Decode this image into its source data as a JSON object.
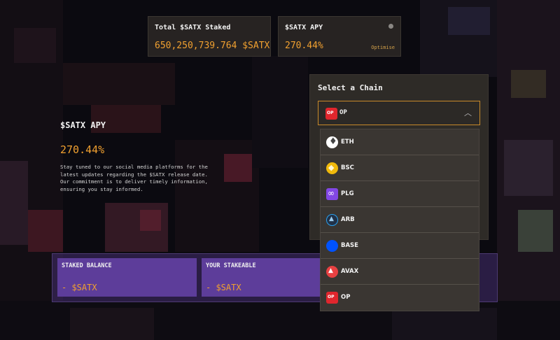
{
  "stats": {
    "total_staked_label": "Total $SATX Staked",
    "total_staked_value": "650,250,739.764 $SATX",
    "apy_label": "$SATX APY",
    "apy_value": "270.44%",
    "apy_link": "Optimise"
  },
  "apy_section": {
    "title": "$SATX APY",
    "value": "270.44%",
    "description": "Stay tuned to our social media platforms for the latest updates regarding the $SATX release date. Our commitment is to deliver timely information, ensuring you stay informed."
  },
  "staking": {
    "staked_balance_label": "STAKED BALANCE",
    "staked_balance_value": "- $SATX",
    "stakeable_label": "YOUR STAKEABLE",
    "stakeable_value": "- $SATX"
  },
  "chain_selector": {
    "title": "Select a Chain",
    "selected": "OP",
    "selected_icon": "op-icon",
    "options": [
      {
        "label": "ETH",
        "icon": "eth-icon"
      },
      {
        "label": "BSC",
        "icon": "bsc-icon"
      },
      {
        "label": "PLG",
        "icon": "plg-icon"
      },
      {
        "label": "ARB",
        "icon": "arb-icon"
      },
      {
        "label": "BASE",
        "icon": "base-icon"
      },
      {
        "label": "AVAX",
        "icon": "avax-icon"
      },
      {
        "label": "OP",
        "icon": "op-icon"
      }
    ]
  },
  "colors": {
    "accent_orange": "#f0a030",
    "panel_bg": "#2f2c28",
    "purple": "#5d3d9a",
    "select_border": "#c88a2a"
  }
}
